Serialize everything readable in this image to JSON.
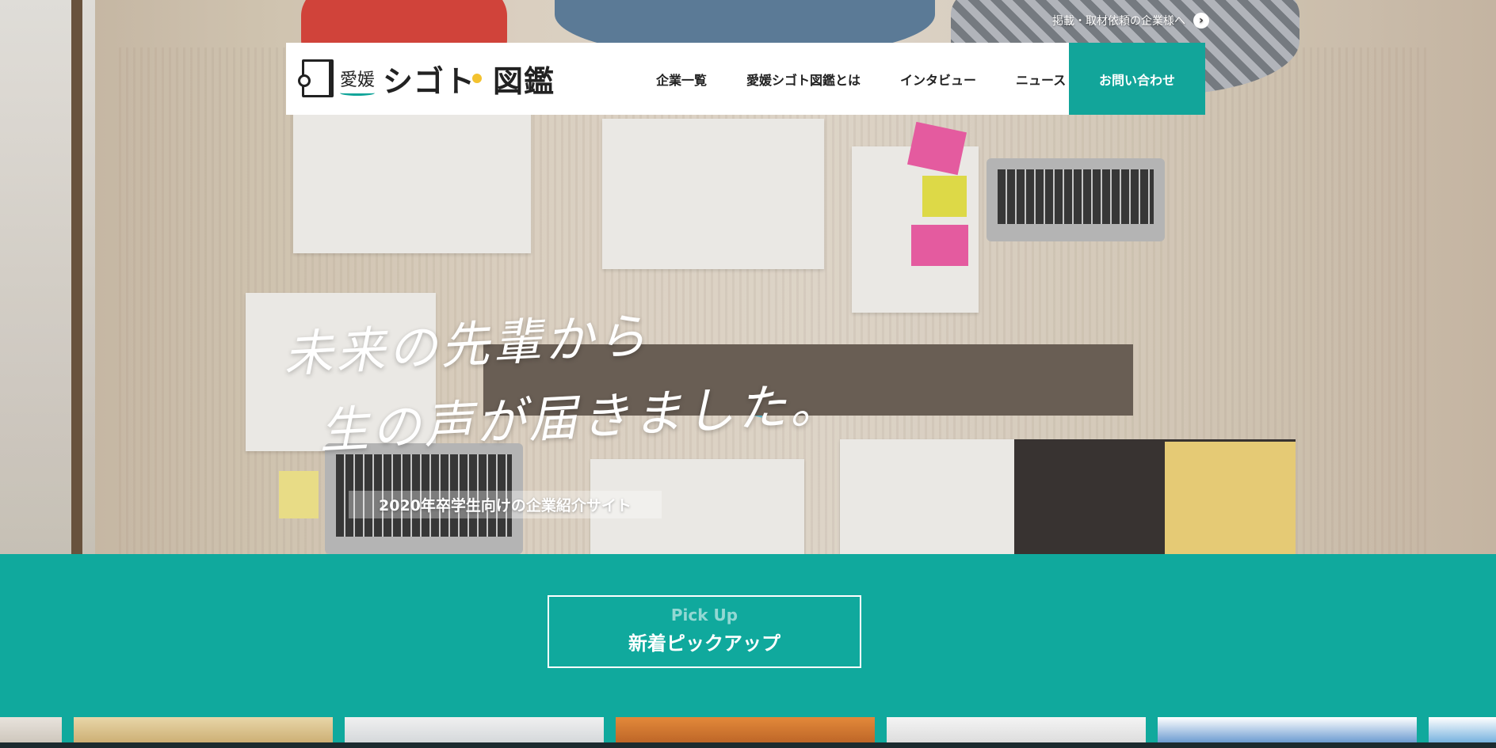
{
  "top_link": {
    "label": "掲載・取材依頼の企業様へ",
    "icon": "arrow-right-circle-icon"
  },
  "header": {
    "logo": {
      "prefecture": "愛媛",
      "shigoto": "シゴト",
      "zukan": "図鑑"
    },
    "nav": [
      {
        "label": "企業一覧"
      },
      {
        "label": "愛媛シゴト図鑑とは"
      },
      {
        "label": "インタビュー"
      },
      {
        "label": "ニュース"
      }
    ],
    "contact_label": "お問い合わせ"
  },
  "hero": {
    "catch_line1": "未来の先輩から",
    "catch_line2": "生の声が届きました。",
    "subcatch": "2020年卒学生向けの企業紹介サイト"
  },
  "pickup": {
    "label_en": "Pick Up",
    "label_ja": "新着ピックアップ"
  },
  "colors": {
    "accent": "#12a59a",
    "band": "#10a99d",
    "white": "#ffffff"
  }
}
